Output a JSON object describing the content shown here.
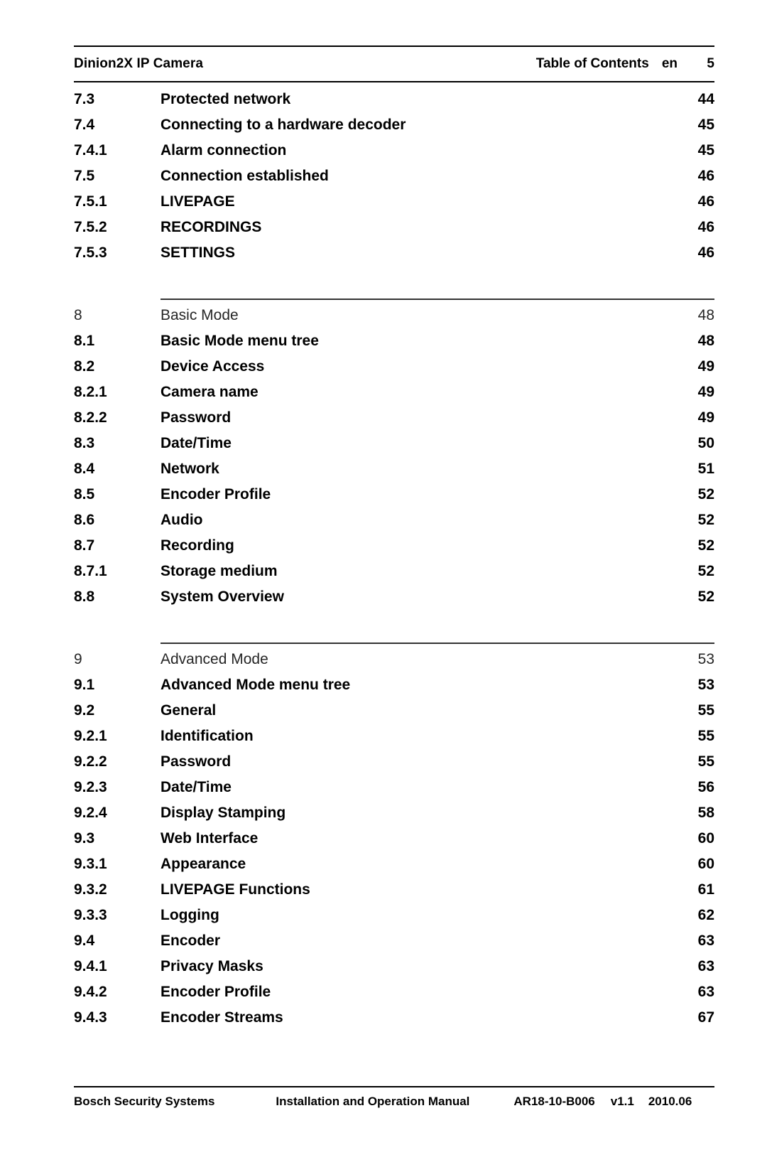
{
  "header": {
    "document_title": "Dinion2X IP Camera",
    "section_title": "Table of Contents",
    "language": "en",
    "page_number": "5"
  },
  "toc": {
    "blocks": [
      {
        "has_rule": false,
        "rows": [
          {
            "number": "7.3",
            "title": "Protected network",
            "page": "44",
            "level": "sub"
          },
          {
            "number": "7.4",
            "title": "Connecting to a hardware decoder",
            "page": "45",
            "level": "sub"
          },
          {
            "number": "7.4.1",
            "title": "Alarm connection",
            "page": "45",
            "level": "sub"
          },
          {
            "number": "7.5",
            "title": "Connection established",
            "page": "46",
            "level": "sub"
          },
          {
            "number": "7.5.1",
            "title": "LIVEPAGE",
            "page": "46",
            "level": "sub"
          },
          {
            "number": "7.5.2",
            "title": "RECORDINGS",
            "page": "46",
            "level": "sub"
          },
          {
            "number": "7.5.3",
            "title": "SETTINGS",
            "page": "46",
            "level": "sub"
          }
        ]
      },
      {
        "has_rule": true,
        "rows": [
          {
            "number": "8",
            "title": "Basic Mode",
            "page": "48",
            "level": "chapter"
          },
          {
            "number": "8.1",
            "title": "Basic Mode menu tree",
            "page": "48",
            "level": "sub"
          },
          {
            "number": "8.2",
            "title": "Device Access",
            "page": "49",
            "level": "sub"
          },
          {
            "number": "8.2.1",
            "title": "Camera name",
            "page": "49",
            "level": "sub"
          },
          {
            "number": "8.2.2",
            "title": "Password",
            "page": "49",
            "level": "sub"
          },
          {
            "number": "8.3",
            "title": "Date/Time",
            "page": "50",
            "level": "sub"
          },
          {
            "number": "8.4",
            "title": "Network",
            "page": "51",
            "level": "sub"
          },
          {
            "number": "8.5",
            "title": "Encoder Profile",
            "page": "52",
            "level": "sub"
          },
          {
            "number": "8.6",
            "title": "Audio",
            "page": "52",
            "level": "sub"
          },
          {
            "number": "8.7",
            "title": "Recording",
            "page": "52",
            "level": "sub"
          },
          {
            "number": "8.7.1",
            "title": "Storage medium",
            "page": "52",
            "level": "sub"
          },
          {
            "number": "8.8",
            "title": "System Overview",
            "page": "52",
            "level": "sub"
          }
        ]
      },
      {
        "has_rule": true,
        "rows": [
          {
            "number": "9",
            "title": "Advanced Mode",
            "page": "53",
            "level": "chapter"
          },
          {
            "number": "9.1",
            "title": "Advanced Mode menu tree",
            "page": "53",
            "level": "sub"
          },
          {
            "number": "9.2",
            "title": "General",
            "page": "55",
            "level": "sub"
          },
          {
            "number": "9.2.1",
            "title": "Identification",
            "page": "55",
            "level": "sub"
          },
          {
            "number": "9.2.2",
            "title": "Password",
            "page": "55",
            "level": "sub"
          },
          {
            "number": "9.2.3",
            "title": "Date/Time",
            "page": "56",
            "level": "sub"
          },
          {
            "number": "9.2.4",
            "title": "Display Stamping",
            "page": "58",
            "level": "sub"
          },
          {
            "number": "9.3",
            "title": "Web Interface",
            "page": "60",
            "level": "sub"
          },
          {
            "number": "9.3.1",
            "title": "Appearance",
            "page": "60",
            "level": "sub"
          },
          {
            "number": "9.3.2",
            "title": "LIVEPAGE Functions",
            "page": "61",
            "level": "sub"
          },
          {
            "number": "9.3.3",
            "title": "Logging",
            "page": "62",
            "level": "sub"
          },
          {
            "number": "9.4",
            "title": "Encoder",
            "page": "63",
            "level": "sub"
          },
          {
            "number": "9.4.1",
            "title": "Privacy Masks",
            "page": "63",
            "level": "sub"
          },
          {
            "number": "9.4.2",
            "title": "Encoder Profile",
            "page": "63",
            "level": "sub"
          },
          {
            "number": "9.4.3",
            "title": "Encoder Streams",
            "page": "67",
            "level": "sub"
          }
        ]
      }
    ]
  },
  "footer": {
    "company": "Bosch Security Systems",
    "document_title": "Installation and Operation Manual",
    "document_number": "AR18-10-B006",
    "version": "v1.1",
    "date": "2010.06"
  }
}
